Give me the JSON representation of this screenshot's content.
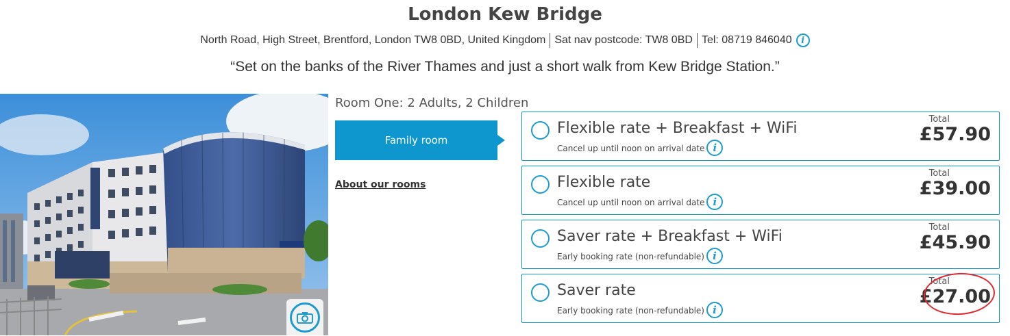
{
  "hotel": {
    "name": "London Kew Bridge",
    "address": "North Road, High Street, Brentford, London TW8 0BD, United Kingdom",
    "satnav": "Sat nav postcode: TW8 0BD",
    "tel": "Tel: 08719 846040",
    "tagline": "“Set on the banks of the River Thames and just a short walk from Kew Bridge Station.”"
  },
  "icons": {
    "info": "i"
  },
  "room": {
    "heading": "Room One: 2 Adults, 2 Children",
    "type_button": "Family room",
    "about_link": "About our rooms"
  },
  "rates": [
    {
      "name": "Flexible rate + Breakfast + WiFi",
      "desc": "Cancel up until noon on arrival date",
      "total_label": "Total",
      "price": "£57.90"
    },
    {
      "name": "Flexible rate",
      "desc": "Cancel up until noon on arrival date",
      "total_label": "Total",
      "price": "£39.00"
    },
    {
      "name": "Saver rate + Breakfast + WiFi",
      "desc": "Early booking rate (non-refundable)",
      "total_label": "Total",
      "price": "£45.90"
    },
    {
      "name": "Saver rate",
      "desc": "Early booking rate (non-refundable)",
      "total_label": "Total",
      "price": "£27.00"
    }
  ],
  "colors": {
    "accent": "#0e97cf",
    "annotation": "#e0282f"
  }
}
